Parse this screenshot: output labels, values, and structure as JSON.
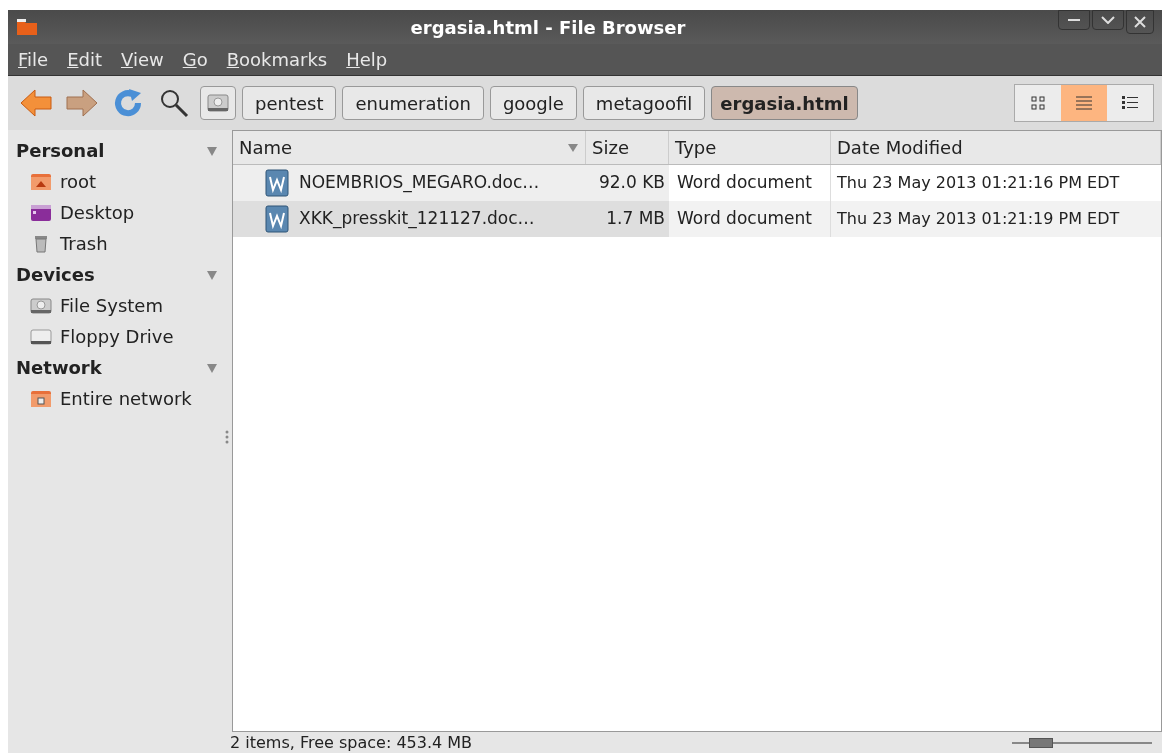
{
  "window": {
    "title": "ergasia.html - File Browser"
  },
  "menu": [
    "File",
    "Edit",
    "View",
    "Go",
    "Bookmarks",
    "Help"
  ],
  "breadcrumbs": [
    {
      "label": "pentest",
      "selected": false
    },
    {
      "label": "enumeration",
      "selected": false
    },
    {
      "label": "google",
      "selected": false
    },
    {
      "label": "metagoofil",
      "selected": false
    },
    {
      "label": "ergasia.html",
      "selected": true
    }
  ],
  "view_modes": [
    {
      "kind": "icons",
      "selected": false
    },
    {
      "kind": "list",
      "selected": true
    },
    {
      "kind": "compact",
      "selected": false
    }
  ],
  "sidebar": [
    {
      "title": "Personal",
      "expanded": true,
      "items": [
        {
          "label": "root",
          "kind": "home"
        },
        {
          "label": "Desktop",
          "kind": "desktop"
        },
        {
          "label": "Trash",
          "kind": "trash"
        }
      ]
    },
    {
      "title": "Devices",
      "expanded": true,
      "items": [
        {
          "label": "File System",
          "kind": "disk"
        },
        {
          "label": "Floppy Drive",
          "kind": "floppy"
        }
      ]
    },
    {
      "title": "Network",
      "expanded": true,
      "items": [
        {
          "label": "Entire network",
          "kind": "network"
        }
      ]
    }
  ],
  "table": {
    "columns": [
      "Name",
      "Size",
      "Type",
      "Date Modified"
    ],
    "rows": [
      {
        "name": "NOEMBRIOS_MEGARO.doc…",
        "size": "92.0 KB",
        "type": "Word document",
        "modified": "Thu 23 May 2013 01:21:16 PM EDT"
      },
      {
        "name": "XKK_presskit_121127.doc…",
        "size": "1.7 MB",
        "type": "Word document",
        "modified": "Thu 23 May 2013 01:21:19 PM EDT"
      }
    ]
  },
  "status_bar": {
    "text": "2 items, Free space: 453.4 MB",
    "zoom": {
      "level": 0.21
    }
  }
}
